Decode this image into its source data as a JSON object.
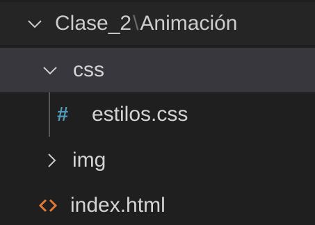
{
  "explorer": {
    "root": {
      "folder": "Clase_2",
      "separator": "\\",
      "subfolder": "Animación",
      "expanded": true
    },
    "items": [
      {
        "label": "css",
        "type": "folder",
        "expanded": true,
        "selected": true
      },
      {
        "label": "estilos.css",
        "type": "file",
        "icon": "css-hash-icon",
        "icon_glyph": "#",
        "icon_color": "#519aba"
      },
      {
        "label": "img",
        "type": "folder",
        "expanded": false
      },
      {
        "label": "index.html",
        "type": "file",
        "icon": "html-code-icon",
        "icon_color": "#e37933"
      }
    ]
  }
}
